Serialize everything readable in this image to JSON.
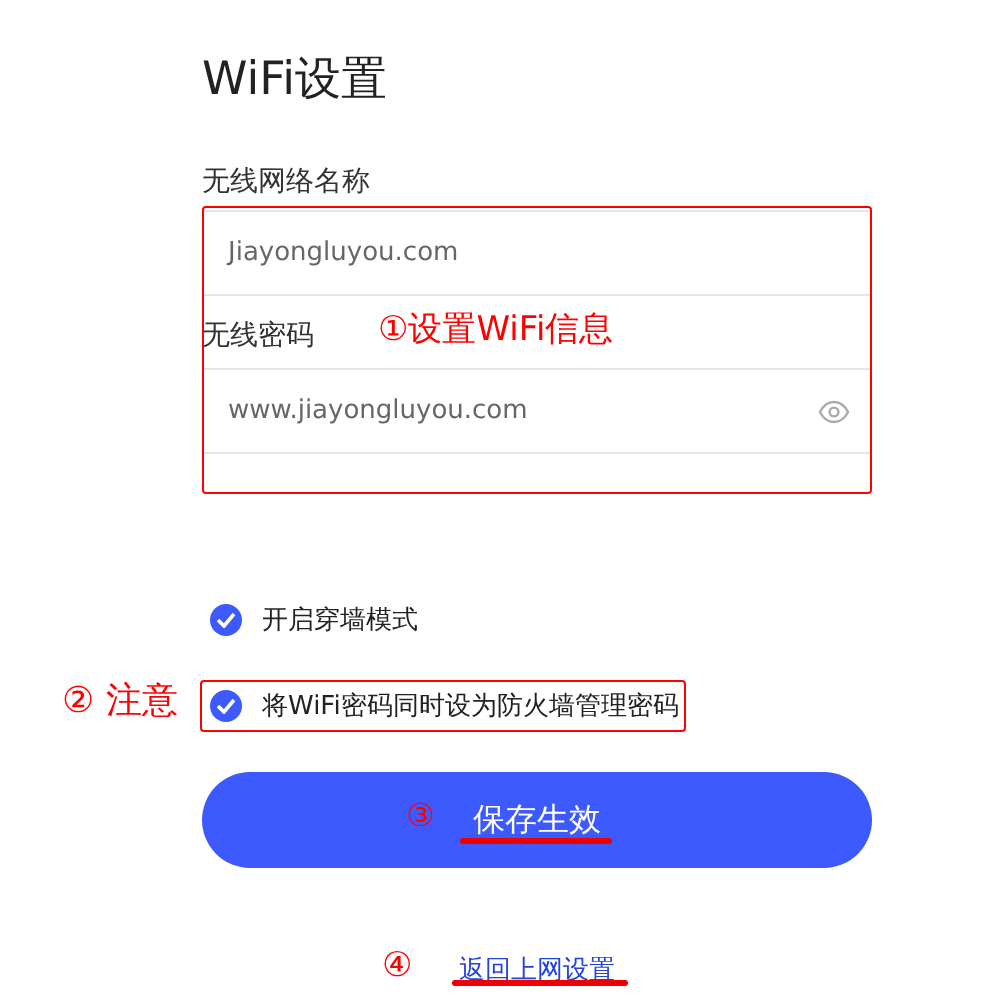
{
  "title": "WiFi设置",
  "fields": [
    {
      "label": "无线网络名称",
      "value": "Jiayongluyou.com",
      "kind": "text"
    },
    {
      "label": "无线密码",
      "value": "www.jiayongluyou.com",
      "kind": "password"
    }
  ],
  "options": [
    {
      "label": "开启穿墙模式",
      "checked": true,
      "highlighted": false
    },
    {
      "label": "将WiFi密码同时设为防火墙管理密码",
      "checked": true,
      "highlighted": true
    }
  ],
  "save_button": "保存生效",
  "back_link": "返回上网设置",
  "annotations": {
    "fields_note": "①设置WiFi信息",
    "option_marker": "②",
    "option_note": "注意",
    "save_marker": "③",
    "link_marker": "④"
  }
}
